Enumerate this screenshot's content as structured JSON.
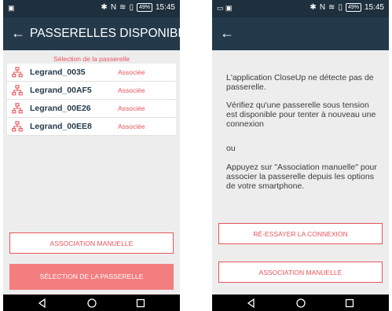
{
  "status_bar": {
    "time": "15:45",
    "battery": "49%",
    "left_icon": "notification-icon",
    "icons": [
      "bluetooth-icon",
      "nfc-icon",
      "wifi-icon",
      "sim-icon"
    ]
  },
  "left_screen": {
    "title": "PASSERELLES DISPONIBLES",
    "section_label": "Sélection de la passerelle",
    "gateways": [
      {
        "name": "Legrand_0035",
        "status": "Associée"
      },
      {
        "name": "Legrand_00AF5",
        "status": "Associée"
      },
      {
        "name": "Legrand_00E26",
        "status": "Associée"
      },
      {
        "name": "Legrand_00EE8",
        "status": "Associée"
      }
    ],
    "manual_button": "ASSOCIATION MANUELLE",
    "select_button": "SÉLECTION DE LA PASSERELLE"
  },
  "right_screen": {
    "title": "",
    "message_1": "L'application CloseUp ne détecte pas de passerelle.",
    "message_2": "Vérifiez qu'une passerelle sous tension est disponible pour tenter à nouveau une connexion",
    "message_3": "ou",
    "message_4": "Appuyez sur \"Association manuelle\" pour associer la passerelle depuis les options de votre smartphone.",
    "retry_button": "RÉ-ESSAYER LA CONNEXION",
    "manual_button": "ASSOCIATION MANUELLE"
  },
  "colors": {
    "status_bar": "#1e2f3d",
    "app_bar": "#243a4b",
    "accent": "#e8545a",
    "accent_filled": "#f37e80",
    "background": "#ededee"
  }
}
